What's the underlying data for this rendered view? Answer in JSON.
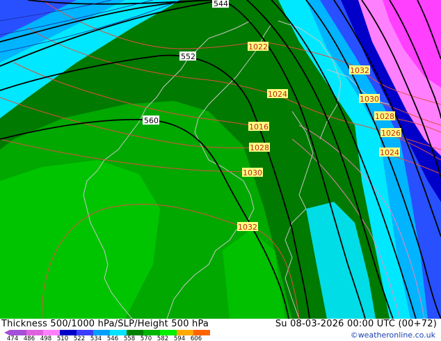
{
  "title": "Thickness 500/1000 hPa/SLP/Height 500 hPa",
  "datetime": "Su 08-03-2026 00:00 UTC (00+72)",
  "credit": "©weatheronline.co.uk",
  "legend": {
    "labels": [
      "474",
      "486",
      "498",
      "510",
      "522",
      "534",
      "546",
      "558",
      "570",
      "582",
      "594",
      "606"
    ],
    "colors": [
      "#a54fd8",
      "#e060e0",
      "#ff80ff",
      "#0000c8",
      "#3c3cff",
      "#00a0ff",
      "#00e4ff",
      "#008000",
      "#00b400",
      "#00f000",
      "#ffaa00",
      "#ff6400"
    ]
  },
  "map": {
    "height_labels": [
      "544",
      "552",
      "560"
    ],
    "slp_labels": [
      "1022",
      "1024",
      "1016",
      "1028",
      "1030",
      "1032",
      "1032",
      "1030",
      "1028",
      "1026",
      "1024"
    ],
    "colors": {
      "green_dark": "#007a00",
      "green_mid": "#00a000",
      "green_light": "#00c000",
      "cyan": "#00e8ff",
      "sky": "#00b4ff",
      "blue": "#2850ff",
      "navy": "#0000c8",
      "pink": "#ff80ff",
      "magenta": "#ff40ff"
    }
  }
}
